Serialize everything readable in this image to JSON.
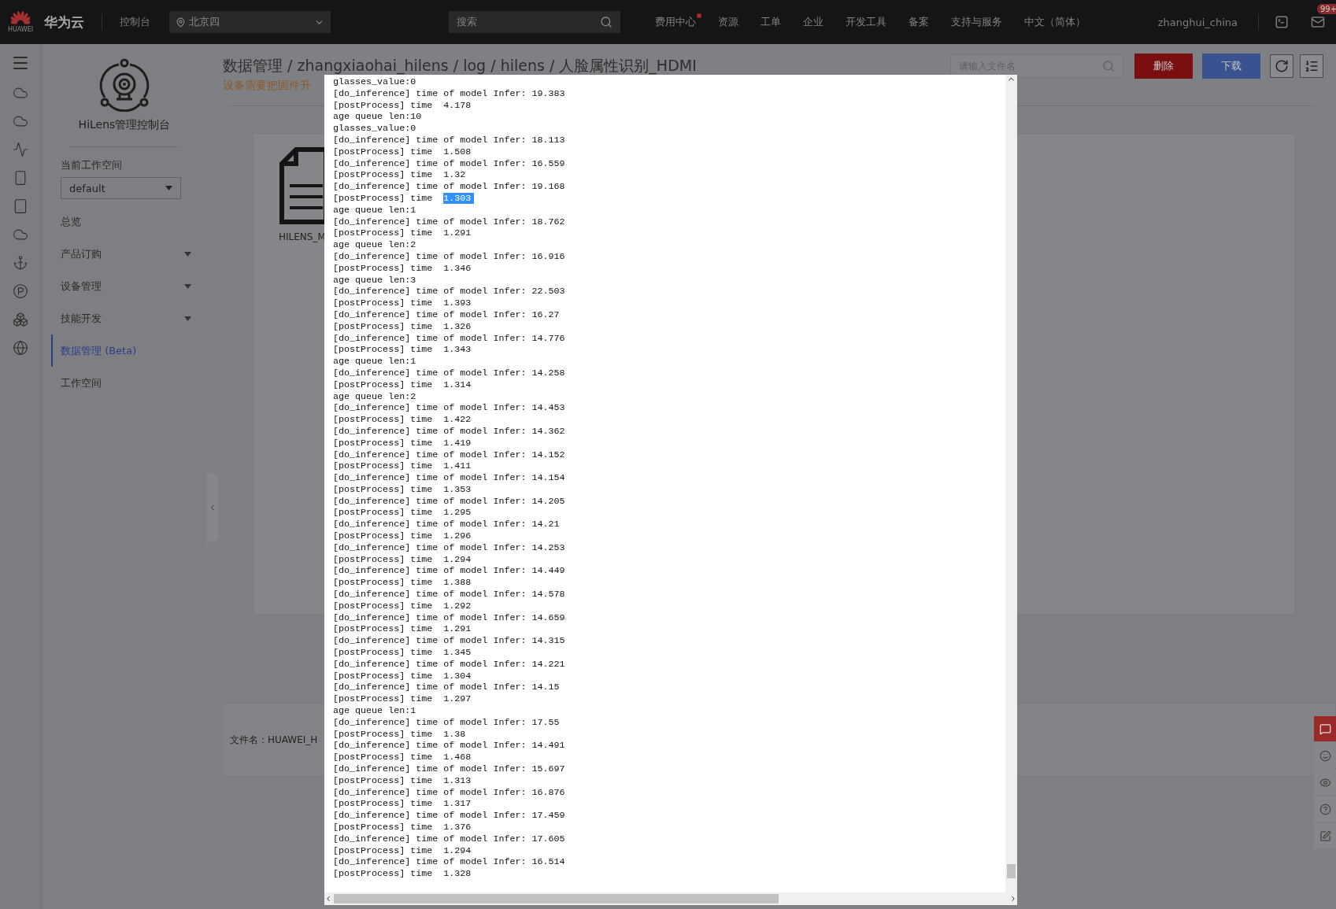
{
  "top_bar": {
    "logo_text": "HUAWEI",
    "brand": "华为云",
    "console": "控制台",
    "region": "北京四",
    "search": {
      "placeholder": "搜索"
    },
    "nav": [
      {
        "label": "费用中心",
        "dot": true
      },
      {
        "label": "资源",
        "dot": false
      },
      {
        "label": "工单",
        "dot": false
      },
      {
        "label": "企业",
        "dot": false
      },
      {
        "label": "开发工具",
        "dot": false
      },
      {
        "label": "备案",
        "dot": false
      },
      {
        "label": "支持与服务",
        "dot": false
      },
      {
        "label": "中文（简体）",
        "dot": false
      }
    ],
    "user": "zhanghui_china",
    "mail_badge": "99+"
  },
  "sidebar": {
    "title": "HiLens管理控制台",
    "workspace_label": "当前工作空间",
    "workspace": "default",
    "items": [
      {
        "label": "总览",
        "has_menu": false,
        "selected": false
      },
      {
        "label": "产品订购",
        "has_menu": true,
        "selected": false
      },
      {
        "label": "设备管理",
        "has_menu": true,
        "selected": false
      },
      {
        "label": "技能开发",
        "has_menu": true,
        "selected": false
      },
      {
        "label": "数据管理 (Beta)",
        "has_menu": false,
        "selected": true
      },
      {
        "label": "工作空间",
        "has_menu": false,
        "selected": false
      }
    ]
  },
  "main": {
    "breadcrumb": "数据管理 / zhangxiaohai_hilens / log / hilens / 人脸属性识别_HDMI",
    "warning": "设备需要把固件升",
    "search": {
      "placeholder": "请输入文件名"
    },
    "delete_button": "删除",
    "download_button": "下载",
    "file_name": "HILENS_M",
    "file_info": "文件名：HUAWEI_H"
  },
  "log_viewer": {
    "lines": [
      {
        "text": "glasses_value:0"
      },
      {
        "text": "[do_inference] time of model Infer: 19.383"
      },
      {
        "text": "[postProcess] time  4.178"
      },
      {
        "text": "age queue len:10"
      },
      {
        "text": "glasses_value:0"
      },
      {
        "text": "[do_inference] time of model Infer: 18.113"
      },
      {
        "text": "[postProcess] time  1.508"
      },
      {
        "text": "[do_inference] time of model Infer: 16.559"
      },
      {
        "text": "[postProcess] time  1.32"
      },
      {
        "text": "[do_inference] time of model Infer: 19.168"
      },
      {
        "text": "[postProcess] time  ",
        "selected_text": "1.303"
      },
      {
        "text": "age queue len:1"
      },
      {
        "text": "[do_inference] time of model Infer: 18.762"
      },
      {
        "text": "[postProcess] time  1.291"
      },
      {
        "text": "age queue len:2"
      },
      {
        "text": "[do_inference] time of model Infer: 16.916"
      },
      {
        "text": "[postProcess] time  1.346"
      },
      {
        "text": "age queue len:3"
      },
      {
        "text": "[do_inference] time of model Infer: 22.503"
      },
      {
        "text": "[postProcess] time  1.393"
      },
      {
        "text": "[do_inference] time of model Infer: 16.27"
      },
      {
        "text": "[postProcess] time  1.326"
      },
      {
        "text": "[do_inference] time of model Infer: 14.776"
      },
      {
        "text": "[postProcess] time  1.343"
      },
      {
        "text": "age queue len:1"
      },
      {
        "text": "[do_inference] time of model Infer: 14.258"
      },
      {
        "text": "[postProcess] time  1.314"
      },
      {
        "text": "age queue len:2"
      },
      {
        "text": "[do_inference] time of model Infer: 14.453"
      },
      {
        "text": "[postProcess] time  1.422"
      },
      {
        "text": "[do_inference] time of model Infer: 14.362"
      },
      {
        "text": "[postProcess] time  1.419"
      },
      {
        "text": "[do_inference] time of model Infer: 14.152"
      },
      {
        "text": "[postProcess] time  1.411"
      },
      {
        "text": "[do_inference] time of model Infer: 14.154"
      },
      {
        "text": "[postProcess] time  1.353"
      },
      {
        "text": "[do_inference] time of model Infer: 14.205"
      },
      {
        "text": "[postProcess] time  1.295"
      },
      {
        "text": "[do_inference] time of model Infer: 14.21"
      },
      {
        "text": "[postProcess] time  1.296"
      },
      {
        "text": "[do_inference] time of model Infer: 14.253"
      },
      {
        "text": "[postProcess] time  1.294"
      },
      {
        "text": "[do_inference] time of model Infer: 14.449"
      },
      {
        "text": "[postProcess] time  1.388"
      },
      {
        "text": "[do_inference] time of model Infer: 14.578"
      },
      {
        "text": "[postProcess] time  1.292"
      },
      {
        "text": "[do_inference] time of model Infer: 14.659"
      },
      {
        "text": "[postProcess] time  1.291"
      },
      {
        "text": "[do_inference] time of model Infer: 14.315"
      },
      {
        "text": "[postProcess] time  1.345"
      },
      {
        "text": "[do_inference] time of model Infer: 14.221"
      },
      {
        "text": "[postProcess] time  1.304"
      },
      {
        "text": "[do_inference] time of model Infer: 14.15"
      },
      {
        "text": "[postProcess] time  1.297"
      },
      {
        "text": "age queue len:1"
      },
      {
        "text": "[do_inference] time of model Infer: 17.55"
      },
      {
        "text": "[postProcess] time  1.38"
      },
      {
        "text": "[do_inference] time of model Infer: 14.491"
      },
      {
        "text": "[postProcess] time  1.468"
      },
      {
        "text": "[do_inference] time of model Infer: 15.697"
      },
      {
        "text": "[postProcess] time  1.313"
      },
      {
        "text": "[do_inference] time of model Infer: 16.876"
      },
      {
        "text": "[postProcess] time  1.317"
      },
      {
        "text": "[do_inference] time of model Infer: 17.459"
      },
      {
        "text": "[postProcess] time  1.376"
      },
      {
        "text": "[do_inference] time of model Infer: 17.605"
      },
      {
        "text": "[postProcess] time  1.294"
      },
      {
        "text": "[do_inference] time of model Infer: 16.514"
      },
      {
        "text": "[postProcess] time  1.328"
      }
    ]
  }
}
